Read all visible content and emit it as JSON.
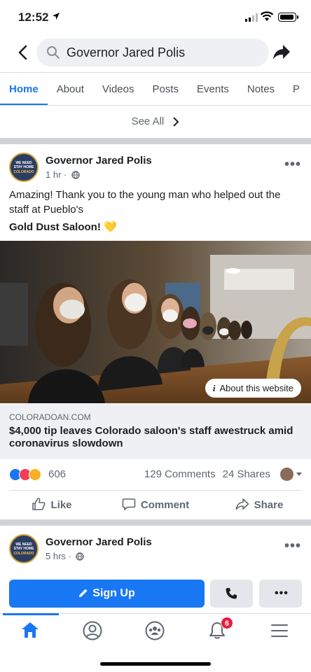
{
  "status_bar": {
    "time": "12:52"
  },
  "search": {
    "query": "Governor Jared Polis"
  },
  "tabs": [
    {
      "label": "Home",
      "active": true
    },
    {
      "label": "About"
    },
    {
      "label": "Videos"
    },
    {
      "label": "Posts"
    },
    {
      "label": "Events"
    },
    {
      "label": "Notes"
    },
    {
      "label": "P"
    }
  ],
  "see_all": "See All",
  "avatar_text": [
    "WE NEED",
    "STAY HOME",
    "COLORADO"
  ],
  "post1": {
    "author": "Governor Jared Polis",
    "time": "1 hr",
    "text_line1": "Amazing! Thank you to the young man who helped out the staff at Pueblo's",
    "text_bold": "Gold Dust Saloon!",
    "emoji": "💛",
    "about_website": "About this website",
    "link_domain": "COLORADOAN.COM",
    "link_headline": "$4,000 tip leaves Colorado saloon's staff awestruck amid coronavirus slowdown",
    "reaction_count": "606",
    "comments": "129 Comments",
    "shares": "24 Shares",
    "actions": {
      "like": "Like",
      "comment": "Comment",
      "share": "Share"
    }
  },
  "post2": {
    "author": "Governor Jared Polis",
    "time": "5 hrs"
  },
  "cta": {
    "signup": "Sign Up"
  },
  "nav": {
    "notification_badge": "6"
  },
  "colors": {
    "accent": "#1877f2",
    "badge": "#e41e3f"
  }
}
